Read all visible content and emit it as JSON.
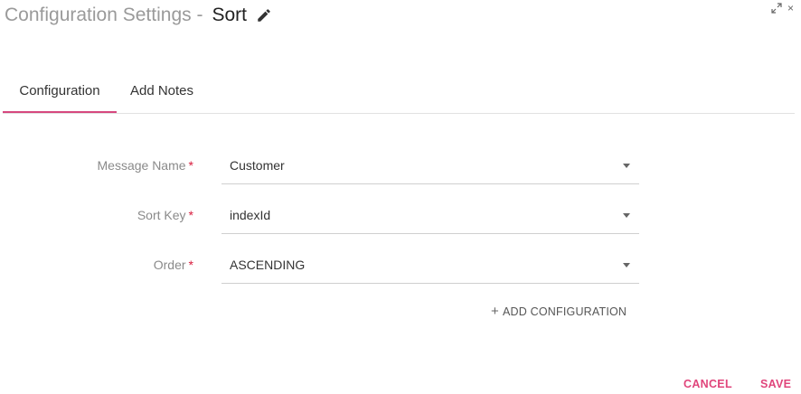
{
  "header": {
    "title_prefix": "Configuration Settings -",
    "title_name": "Sort"
  },
  "window_controls": {
    "expand_icon": "expand-icon",
    "close_glyph": "×"
  },
  "tabs": [
    {
      "label": "Configuration",
      "active": true
    },
    {
      "label": "Add Notes",
      "active": false
    }
  ],
  "form": {
    "required_marker": "*",
    "fields": [
      {
        "label": "Message Name",
        "value": "Customer"
      },
      {
        "label": "Sort Key",
        "value": "indexId"
      },
      {
        "label": "Order",
        "value": "ASCENDING"
      }
    ]
  },
  "add_configuration": {
    "plus": "+",
    "label": "ADD CONFIGURATION"
  },
  "footer": {
    "cancel_label": "CANCEL",
    "save_label": "SAVE"
  },
  "colors": {
    "accent": "#d6487e",
    "required": "#d81b3c",
    "title_muted": "#9a9a9a"
  }
}
